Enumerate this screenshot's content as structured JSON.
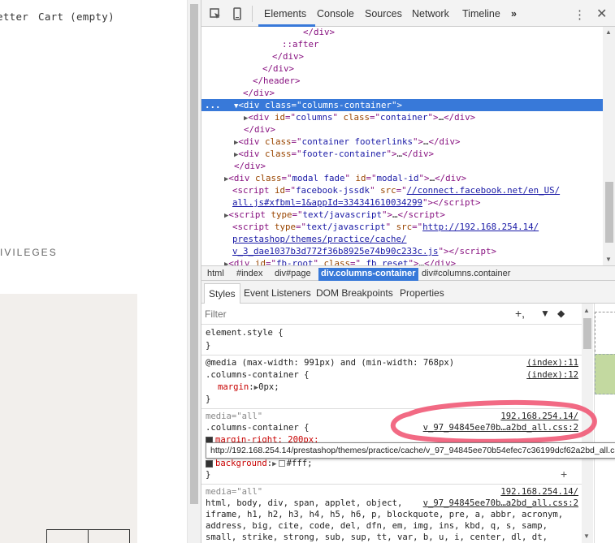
{
  "page": {
    "nav_newsletter": "etter",
    "nav_cart": "Cart (empty)",
    "privileges": "IVILEGES"
  },
  "toolbar": {
    "tabs": [
      "Elements",
      "Console",
      "Sources",
      "Network",
      "Timeline"
    ],
    "more": "»",
    "menu": "⋮",
    "close": "✕"
  },
  "dom": {
    "ellipsis": "...",
    "l_after": "::after",
    "class_columns": "columns-container",
    "id_columns": "columns",
    "class_container": "container",
    "class_footerlinks": "container footerlinks",
    "class_footer": "footer-container",
    "class_modal": "modal fade",
    "id_modal": "modal-id",
    "id_fb": "facebook-jssdk",
    "fb_src_1": "//connect.facebook.net/en_US/",
    "fb_src_2": "all.js#xfbml=1&appId=334341610034299",
    "type_js": "text/javascript",
    "src_1": "http://192.168.254.14/",
    "src_2": "prestashop/themes/practice/cache/",
    "src_3": "v_3_dae1037b3d772f36b8925e74b90c233c.js",
    "id_fbroot": "fb-root",
    "class_fbreset": " fb_reset"
  },
  "breadcrumbs": [
    "html",
    "#index",
    "div#page",
    "div.columns-container",
    "div#columns.container"
  ],
  "subtabs": [
    "Styles",
    "Event Listeners",
    "DOM Breakpoints",
    "Properties"
  ],
  "filter": {
    "placeholder": "Filter"
  },
  "styles": {
    "element_style": "element.style {",
    "close_brace": "}",
    "media1": "@media (max-width: 991px) and (min-width: 768px)",
    "media1_src1": "(index):11",
    "selector1": ".columns-container {",
    "media1_src2": "(index):12",
    "prop_margin": "margin",
    "val_margin": "0px;",
    "media2": "media=\"all\"",
    "media2_src1": "192.168.254.14/",
    "selector2": ".columns-container {",
    "media2_src2": "v_97_94845ee70b…a2bd_all.css:2",
    "prop_margin_right": "margin-right: 200px;",
    "prop_background": "background",
    "val_background": "#fff;",
    "media3": "media=\"all\"",
    "media3_src1": "192.168.254.14/",
    "media3_src2": "v_97_94845ee70b…a2bd_all.css:2",
    "reset1": "html, body, div, span, applet, object,",
    "reset2": "iframe, h1, h2, h3, h4, h5, h6, p, blockquote, pre, a, abbr, acronym,",
    "reset3": "address, big, cite, code, del, dfn, em, img, ins, kbd, q, s, samp,",
    "reset4": "small, strike, strong, sub, sup, tt, var, b, u, i, center, dl, dt,"
  },
  "tooltip": "http://192.168.254.14/prestashop/themes/practice/cache/v_97_94845ee70b54efec7c36199dcf62a2bd_all.css",
  "colors": {
    "accent": "#3879d9",
    "annotation": "#f0506e"
  }
}
